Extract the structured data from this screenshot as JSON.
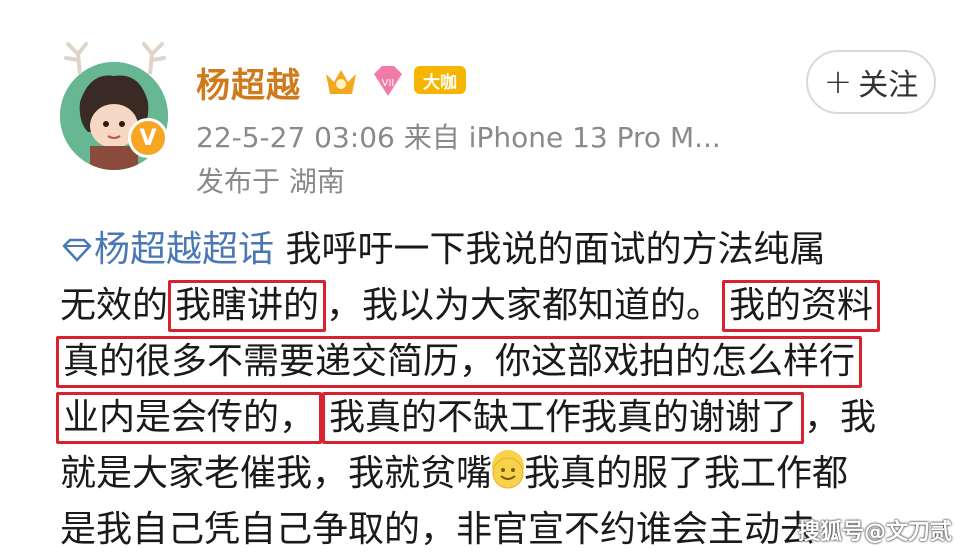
{
  "header": {
    "username": "杨超越",
    "badge_tag": "大咖",
    "follow_label": "关注",
    "follow_plus": "+",
    "timestamp": "22-5-27 03:06",
    "source": "来自 iPhone 13 Pro M...",
    "location": "发布于 湖南"
  },
  "post": {
    "topic": "杨超越超话",
    "line1_rest": " 我呼吁一下我说的面试的方法纯属",
    "line2_prefix": "无效的",
    "line2_hl": "我瞎讲的",
    "line2_mid": "，我以为大家都知道的。",
    "line2_hl2": "我的资料",
    "line3_hl": "真的很多不需要递交简历，你这部戏拍的怎么样行",
    "line4_hl": "业内是会传的，",
    "line4_hl2": "我真的不缺工作我真的谢谢了",
    "line4_suffix": "，我",
    "line5_a": "就是大家老催我，我就贫嘴",
    "line5_b": "我真的服了我工作都",
    "line6": "是我自己凭自己争取的，非官宣不约谁会主动去"
  },
  "watermark": "搜狐号@文刀贰",
  "colors": {
    "username": "#d07a1c",
    "topic": "#4a78b6",
    "highlight": "#d8222f"
  }
}
